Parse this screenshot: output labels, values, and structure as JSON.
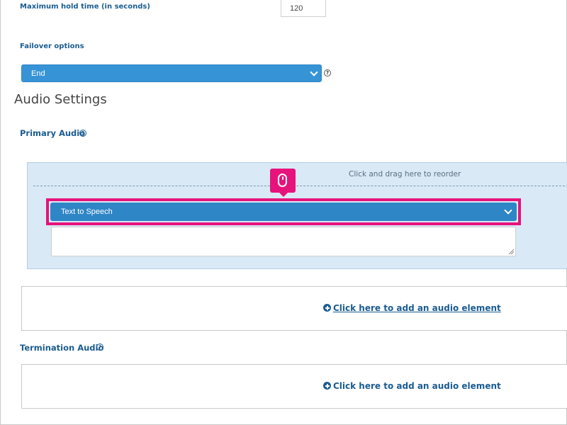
{
  "hold_time": {
    "label": "Maximum hold time (in seconds)",
    "value": "120"
  },
  "failover": {
    "label": "Failover options",
    "selected": "End",
    "help_glyph": "?"
  },
  "audio_settings": {
    "title": "Audio Settings",
    "primary": {
      "label": "Primary Audio",
      "help_glyph": "?",
      "drag_hint": "Click and drag here to reorder",
      "type_selected": "Text to Speech",
      "text_value": "",
      "add_link": "Click here to add an audio element"
    },
    "termination": {
      "label": "Termination Audio",
      "help_glyph": "?",
      "add_link": "Click here to add an audio element"
    }
  },
  "colors": {
    "accent": "#3694d6",
    "brand_text": "#1b5c91",
    "highlight": "#e6137c",
    "element_bg": "#d9e9f5"
  },
  "icons": {
    "help": "help-icon",
    "chevron": "chevron-down-icon",
    "mouse": "mouse-click-icon",
    "add": "plus-circle-icon"
  }
}
